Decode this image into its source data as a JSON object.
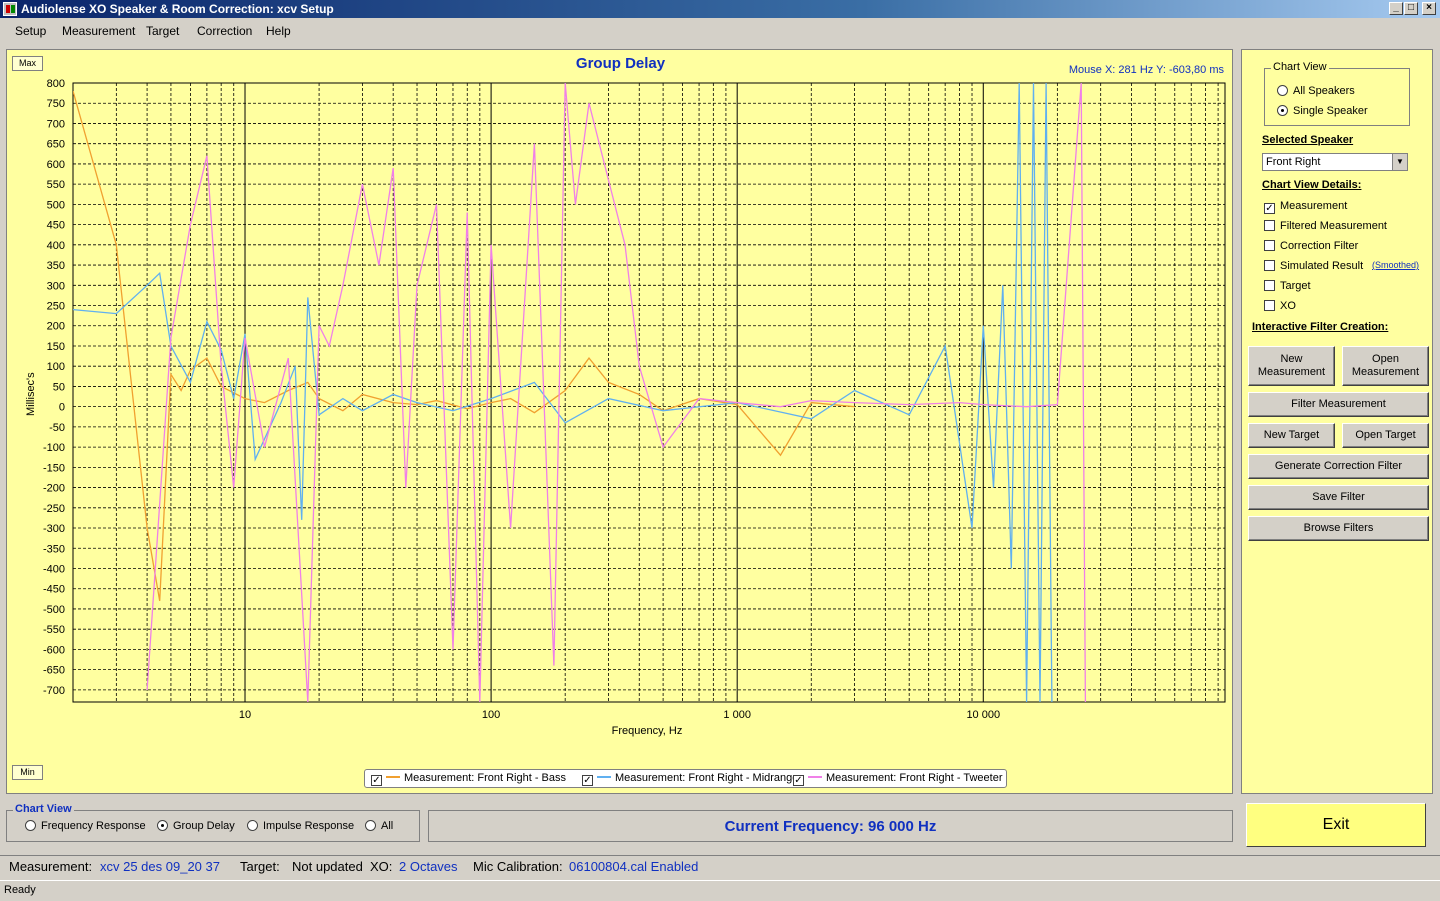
{
  "window": {
    "title": "Audiolense XO Speaker & Room Correction: xcv Setup",
    "controls": [
      "_",
      "□",
      "×"
    ]
  },
  "menu": [
    "Setup",
    "Measurement",
    "Target",
    "Correction",
    "Help"
  ],
  "chart_panel": {
    "max_label": "Max",
    "min_label": "Min",
    "mouse_readout": "Mouse X: 281 Hz   Y: -603,80 ms"
  },
  "chart_data": {
    "type": "line",
    "title": "Group Delay",
    "xlabel": "Frequency, Hz",
    "ylabel": "Millisec's",
    "x_scale": "log",
    "xlim": [
      2,
      96000
    ],
    "ylim": [
      -730,
      800
    ],
    "x_ticks": [
      10,
      100,
      1000,
      10000
    ],
    "x_tick_labels": [
      "10",
      "100",
      "1 000",
      "10 000"
    ],
    "y_ticks": [
      800,
      750,
      700,
      650,
      600,
      550,
      500,
      450,
      400,
      350,
      300,
      250,
      200,
      150,
      100,
      50,
      0,
      -50,
      -100,
      -150,
      -200,
      -250,
      -300,
      -350,
      -400,
      -450,
      -500,
      -550,
      -600,
      -650,
      -700
    ],
    "grid": true,
    "legend_position": "bottom-center",
    "series": [
      {
        "name": "Measurement: Front Right - Bass",
        "color": "#f0a030",
        "x": [
          2,
          3,
          4,
          4.5,
          5,
          5.5,
          6,
          7,
          8,
          10,
          12,
          15,
          18,
          20,
          25,
          30,
          40,
          50,
          60,
          80,
          100,
          120,
          150,
          200,
          250,
          300,
          400,
          500,
          700,
          1000,
          1500,
          2000,
          3000
        ],
        "y": [
          780,
          400,
          -300,
          -480,
          80,
          40,
          90,
          120,
          50,
          20,
          10,
          40,
          60,
          20,
          -10,
          30,
          10,
          5,
          15,
          -5,
          10,
          20,
          -15,
          40,
          120,
          60,
          30,
          -10,
          20,
          5,
          -120,
          10,
          0
        ]
      },
      {
        "name": "Measurement: Front Right - Midrange",
        "color": "#60b0f0",
        "x": [
          2,
          3,
          4,
          4.5,
          5,
          6,
          7,
          8,
          9,
          10,
          11,
          12,
          14,
          16,
          17,
          18,
          20,
          25,
          30,
          40,
          50,
          70,
          100,
          150,
          200,
          300,
          500,
          1000,
          2000,
          3000,
          5000,
          7000,
          9000,
          10000,
          11000,
          12000,
          13000,
          14000,
          15000,
          16000,
          17000,
          18000,
          19000
        ],
        "y": [
          240,
          230,
          300,
          330,
          150,
          60,
          210,
          140,
          20,
          180,
          -130,
          -80,
          10,
          100,
          -280,
          270,
          -20,
          20,
          -10,
          30,
          10,
          -10,
          20,
          60,
          -40,
          20,
          -10,
          10,
          -30,
          40,
          -20,
          150,
          -300,
          200,
          -200,
          300,
          -400,
          800,
          -730,
          800,
          -730,
          800,
          -730
        ]
      },
      {
        "name": "Measurement: Front Right - Tweeter",
        "color": "#f080e8",
        "x": [
          4,
          5,
          6,
          7,
          8,
          9,
          10,
          12,
          15,
          18,
          20,
          22,
          25,
          30,
          35,
          40,
          45,
          50,
          60,
          70,
          80,
          90,
          100,
          120,
          150,
          180,
          200,
          220,
          250,
          300,
          350,
          400,
          500,
          700,
          1000,
          1500,
          2000,
          3000,
          5000,
          8000,
          10000,
          15000,
          20000,
          25000,
          26000
        ],
        "y": [
          -700,
          170,
          450,
          620,
          100,
          -200,
          170,
          -100,
          120,
          -730,
          200,
          150,
          300,
          550,
          350,
          590,
          -200,
          300,
          500,
          -600,
          480,
          -730,
          400,
          -300,
          650,
          -640,
          800,
          500,
          750,
          560,
          400,
          100,
          -100,
          20,
          10,
          0,
          15,
          10,
          5,
          10,
          5,
          0,
          5,
          800,
          -730
        ]
      }
    ]
  },
  "side_panel": {
    "chart_view_group": "Chart View",
    "all_speakers": "All Speakers",
    "single_speaker": "Single Speaker",
    "selected_speaker_label": "Selected Speaker",
    "selected_speaker_value": "Front Right",
    "details_label": "Chart View Details:",
    "options": [
      {
        "label": "Measurement",
        "checked": true
      },
      {
        "label": "Filtered Measurement",
        "checked": false
      },
      {
        "label": "Correction Filter",
        "checked": false
      },
      {
        "label": "Simulated Result",
        "checked": false
      },
      {
        "label": "Target",
        "checked": false
      },
      {
        "label": "XO",
        "checked": false
      }
    ],
    "smoothed_link": "(Smoothed)",
    "interactive_label": "Interactive Filter Creation:",
    "buttons": {
      "new_measurement": "New Measurement",
      "open_measurement": "Open Measurement",
      "filter_measurement": "Filter Measurement",
      "new_target": "New Target",
      "open_target": "Open Target",
      "generate_correction": "Generate Correction Filter",
      "save_filter": "Save Filter",
      "browse_filters": "Browse Filters"
    }
  },
  "bottom": {
    "chart_view_label": "Chart View",
    "views": [
      {
        "label": "Frequency Response",
        "selected": false
      },
      {
        "label": "Group Delay",
        "selected": true
      },
      {
        "label": "Impulse Response",
        "selected": false
      },
      {
        "label": "All",
        "selected": false
      }
    ],
    "current_frequency": "Current Frequency: 96 000 Hz",
    "exit": "Exit"
  },
  "status_info": {
    "measurement_label": "Measurement:",
    "measurement_value": "xcv 25 des 09_20 37",
    "target_label": "Target:",
    "target_value": "Not updated",
    "xo_label": "XO:",
    "xo_value": "2 Octaves",
    "mic_label": "Mic Calibration:",
    "mic_value": "06100804.cal Enabled"
  },
  "status_bar": "Ready"
}
